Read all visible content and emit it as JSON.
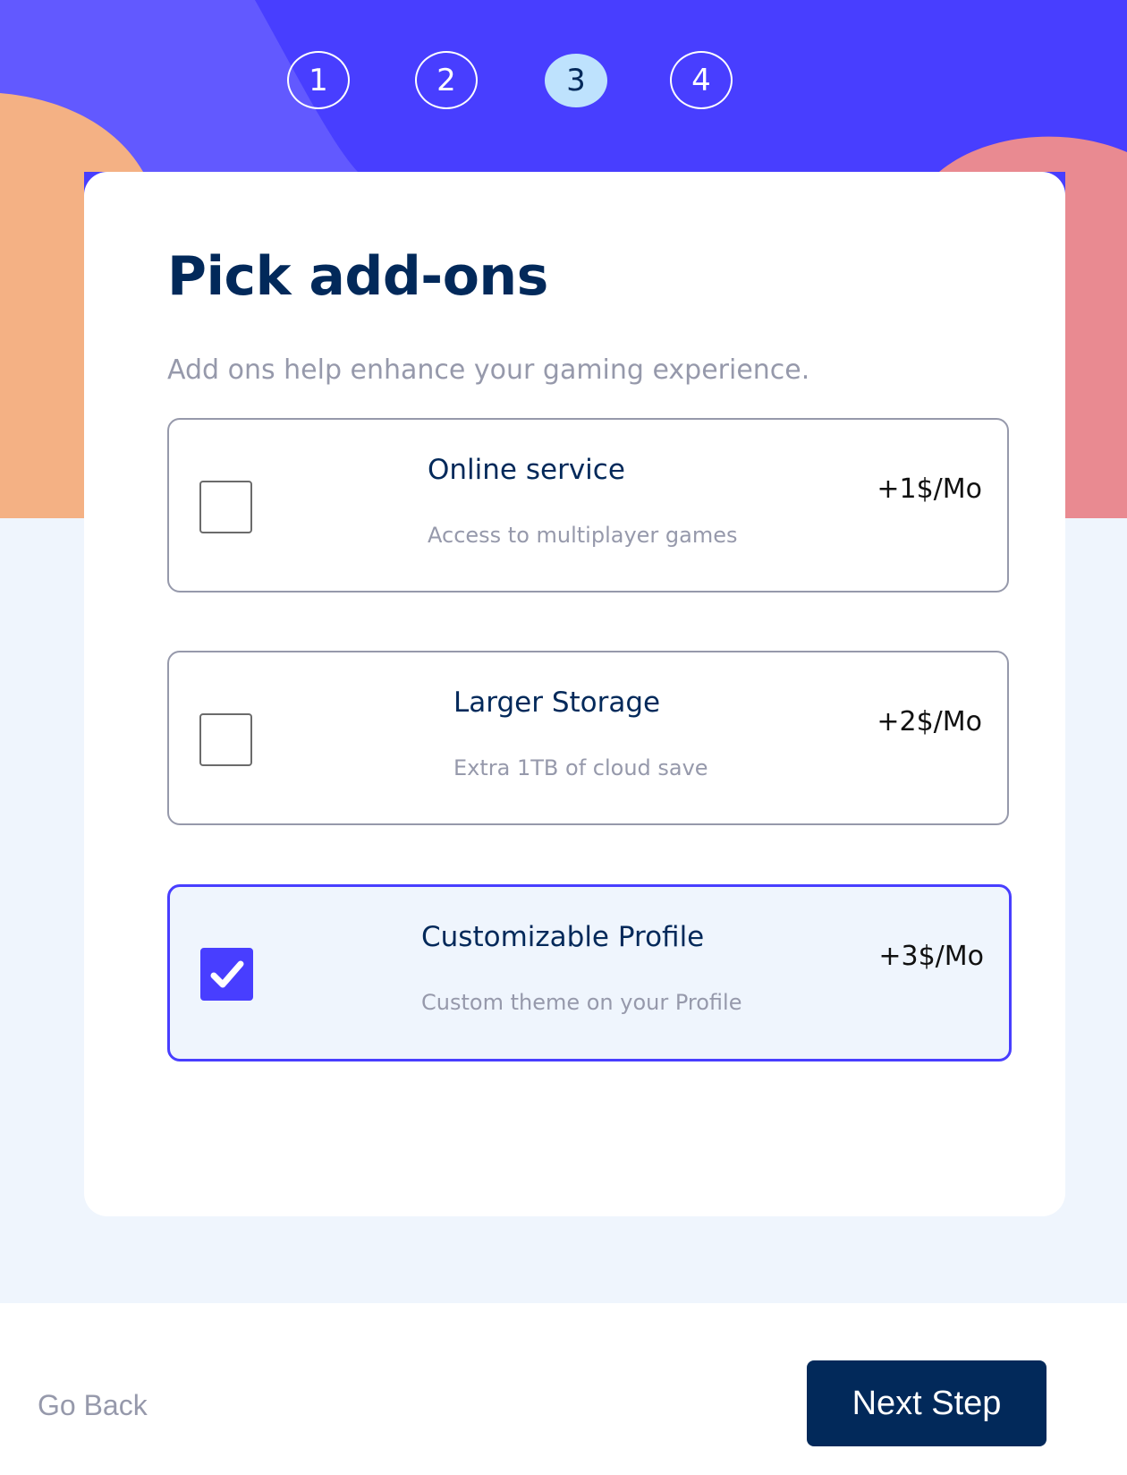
{
  "steps": [
    "1",
    "2",
    "3",
    "4"
  ],
  "current_step": 3,
  "title": "Pick add-ons",
  "subtitle": "Add ons help enhance your gaming experience.",
  "addons": [
    {
      "name": "Online service",
      "description": "Access to multiplayer games",
      "price": "+1$/Mo",
      "checked": false
    },
    {
      "name": "Larger Storage",
      "description": "Extra 1TB of cloud save",
      "price": "+2$/Mo",
      "checked": false
    },
    {
      "name": "Customizable Profile",
      "description": "Custom theme on your Profile",
      "price": "+3$/Mo",
      "checked": true
    }
  ],
  "footer": {
    "back_label": "Go Back",
    "next_label": "Next Step"
  },
  "colors": {
    "primary": "#483eff",
    "marine": "#02295a",
    "orange": "#f4b184",
    "pink": "#e98a91",
    "background": "#eff5fd",
    "gray": "#9699ab"
  }
}
